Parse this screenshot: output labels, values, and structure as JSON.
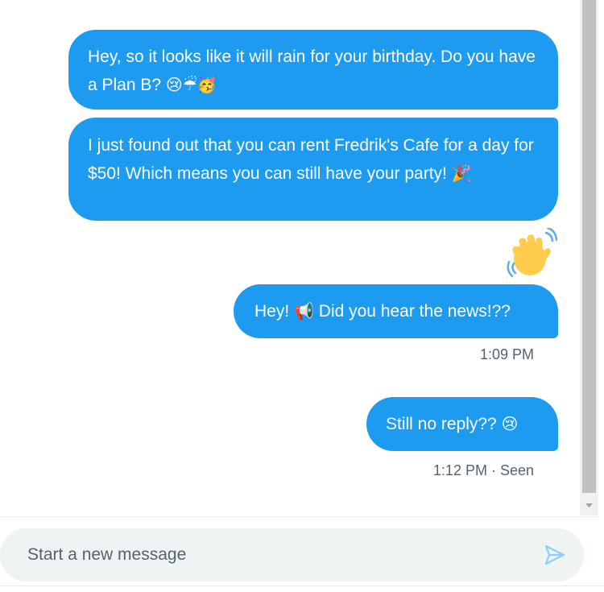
{
  "messages": [
    {
      "text": "Hey, so it looks like it will rain for your birthday. Do you have a Plan B?",
      "emojis": "😢☔🥳",
      "emoji_names": [
        "crying-face-icon",
        "umbrella-icon",
        "party-face-icon"
      ]
    },
    {
      "text": "I just found out that you can rent Fredrik's Cafe for a day for $50! Which means you can still have your party!",
      "emojis": "🎉",
      "emoji_names": [
        "party-popper-icon"
      ]
    },
    {
      "emoji_only": "👋",
      "emoji_names": [
        "waving-hand-icon"
      ]
    },
    {
      "text": "Hey!",
      "emojis": "📢",
      "text_after": "Did you hear the news!??",
      "emoji_names": [
        "megaphone-icon"
      ]
    },
    {
      "text": "Still no reply??",
      "emojis": "😢",
      "emoji_names": [
        "crying-face-icon"
      ]
    }
  ],
  "timestamps": {
    "first": "1:09 PM",
    "second": "1:12 PM · Seen"
  },
  "composer": {
    "placeholder": "Start a new message"
  },
  "colors": {
    "bubble": "#1d9bf0",
    "bubble_text": "#ffffff",
    "meta_text": "#536471",
    "composer_bg": "#eff3f4",
    "send_icon": "#8ecdf8"
  }
}
